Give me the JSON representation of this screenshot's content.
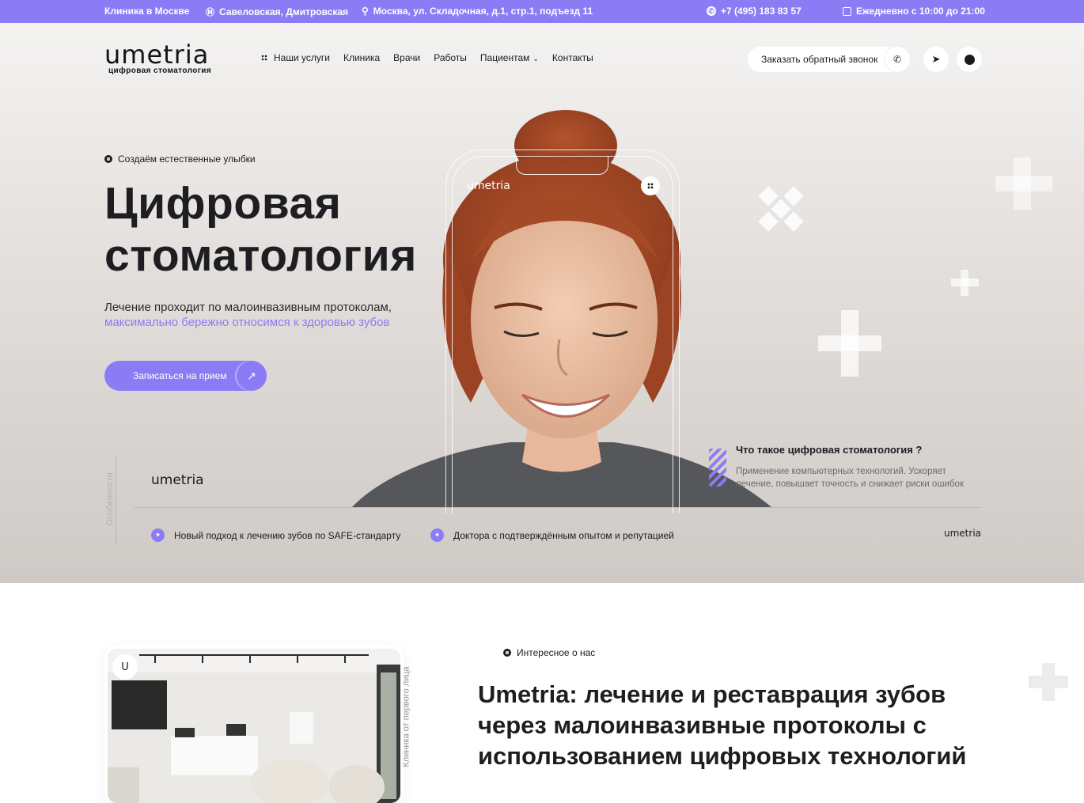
{
  "topbar": {
    "clinic": "Клиника в Москве",
    "metro": "Савеловская, Дмитровская",
    "address": "Москва, ул. Складочная, д.1, стр.1, подъезд 11",
    "phone": "+7 (495) 183 83 57",
    "hours": "Ежедневно с 10:00 до 21:00"
  },
  "header": {
    "logo": "umetria",
    "logo_sub": "цифровая стоматология",
    "nav": [
      "Наши услуги",
      "Клиника",
      "Врачи",
      "Работы",
      "Пациентам",
      "Контакты"
    ],
    "callback": "Заказать обратный звонок"
  },
  "hero": {
    "tag": "Создаём естественные улыбки",
    "title_line1": "Цифровая",
    "title_line2": "стоматология",
    "lead_line1": "Лечение проходит по малоинвазивным протоколам,",
    "lead_line2": "максимально бережно относимся к здоровью зубов",
    "cta": "Записаться на прием",
    "phone_logo": "umetria",
    "question_title": "Что такое цифровая стоматология ?",
    "question_text": "Применение компьютерных технологий. Ускоряет лечение, повышает точность и снижает риски ошибок",
    "side_label": "Особенности",
    "bottom_logo": "umetria",
    "features": [
      "Новый подход к лечению зубов по SAFE-стандарту",
      "Доктора с подтверждённым опытом и репутацией"
    ],
    "small_logo": "umetria"
  },
  "about": {
    "badge": "U",
    "vertical_label": "Клиника от первого лица",
    "tag": "Интересное о нас",
    "title": "Umetria: лечение и реставрация зубов через малоинвазивные протоколы с использованием цифровых технологий"
  },
  "colors": {
    "accent": "#8b7cf6",
    "text": "#1e1e22"
  }
}
